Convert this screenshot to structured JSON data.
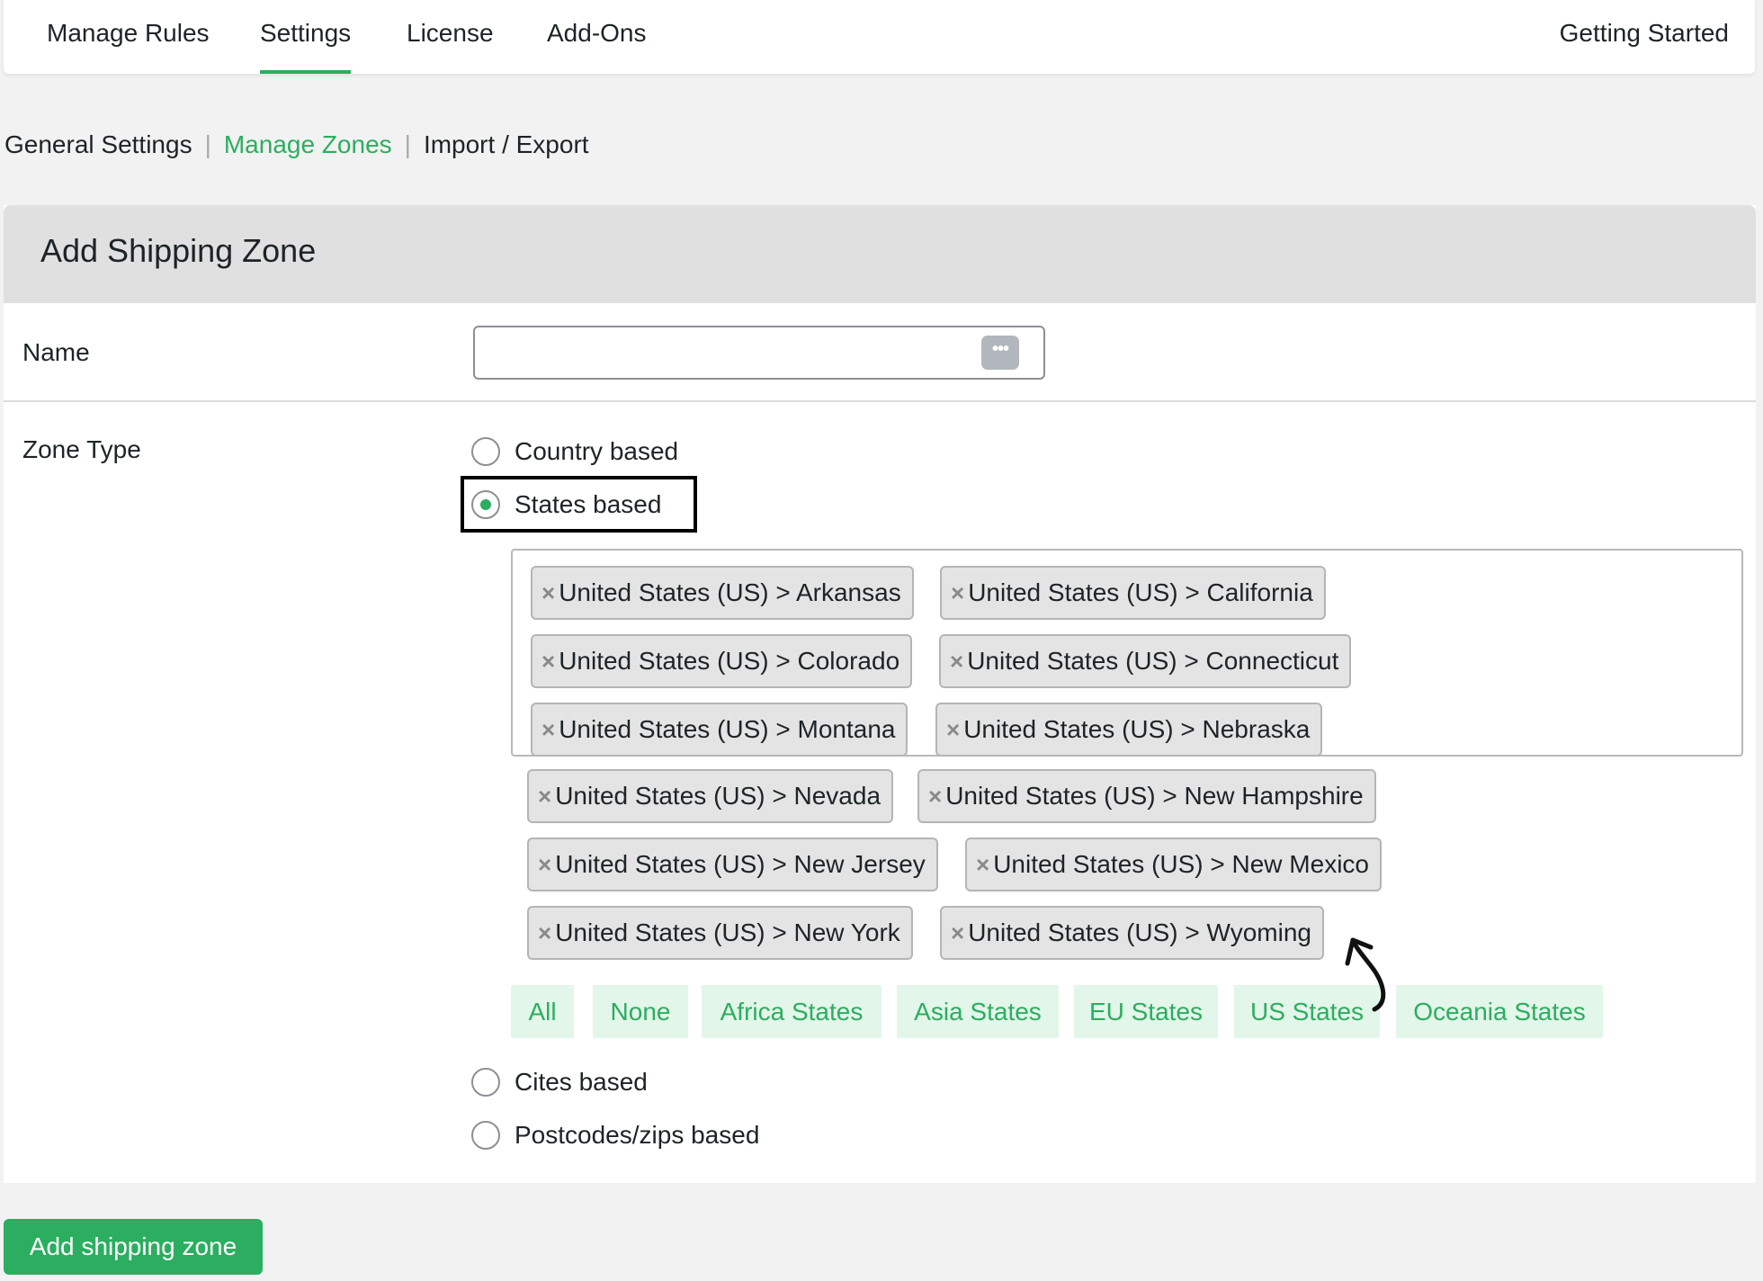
{
  "topnav": {
    "tabs": [
      {
        "label": "Manage Rules"
      },
      {
        "label": "Settings"
      },
      {
        "label": "License"
      },
      {
        "label": "Add-Ons"
      }
    ],
    "active_tab": "Settings",
    "right_link": "Getting Started"
  },
  "subnav": {
    "links": [
      {
        "label": "General Settings"
      },
      {
        "label": "Manage Zones"
      },
      {
        "label": "Import / Export"
      }
    ],
    "active": "Manage Zones",
    "separator": "|"
  },
  "panel": {
    "title": "Add Shipping Zone",
    "name_label": "Name",
    "name_value": "",
    "zone_type_label": "Zone Type",
    "zone_types": [
      {
        "label": "Country based",
        "checked": false
      },
      {
        "label": "States based",
        "checked": true
      },
      {
        "label": "Cites based",
        "checked": false
      },
      {
        "label": "Postcodes/zips based",
        "checked": false
      }
    ],
    "tag_remove_glyph": "×",
    "selected_states": [
      "United States (US) > Arkansas",
      "United States (US) > California",
      "United States (US) > Colorado",
      "United States (US) > Connecticut",
      "United States (US) > Montana",
      "United States (US) > Nebraska",
      "United States (US) > Nevada",
      "United States (US) > New Hampshire",
      "United States (US) > New Jersey",
      "United States (US) > New Mexico",
      "United States (US) > New York",
      "United States (US) > Wyoming"
    ],
    "quick_select": [
      {
        "label": "All"
      },
      {
        "label": "None"
      },
      {
        "label": "Africa States"
      },
      {
        "label": "Asia States"
      },
      {
        "label": "EU States"
      },
      {
        "label": "US States"
      },
      {
        "label": "Oceania States"
      }
    ]
  },
  "submit": {
    "label": "Add shipping zone"
  },
  "colors": {
    "accent": "#2bae5f",
    "accent_light": "#e3f6ea",
    "header_bg": "#e0e0e0",
    "page_bg": "#f2f2f2",
    "tag_bg": "#e4e4e4",
    "highlight_box": "#000000"
  },
  "icons": {
    "input_addon": "password-manager-ellipsis-icon",
    "annotation": "curved-arrow-icon",
    "tag_remove": "close-icon"
  }
}
